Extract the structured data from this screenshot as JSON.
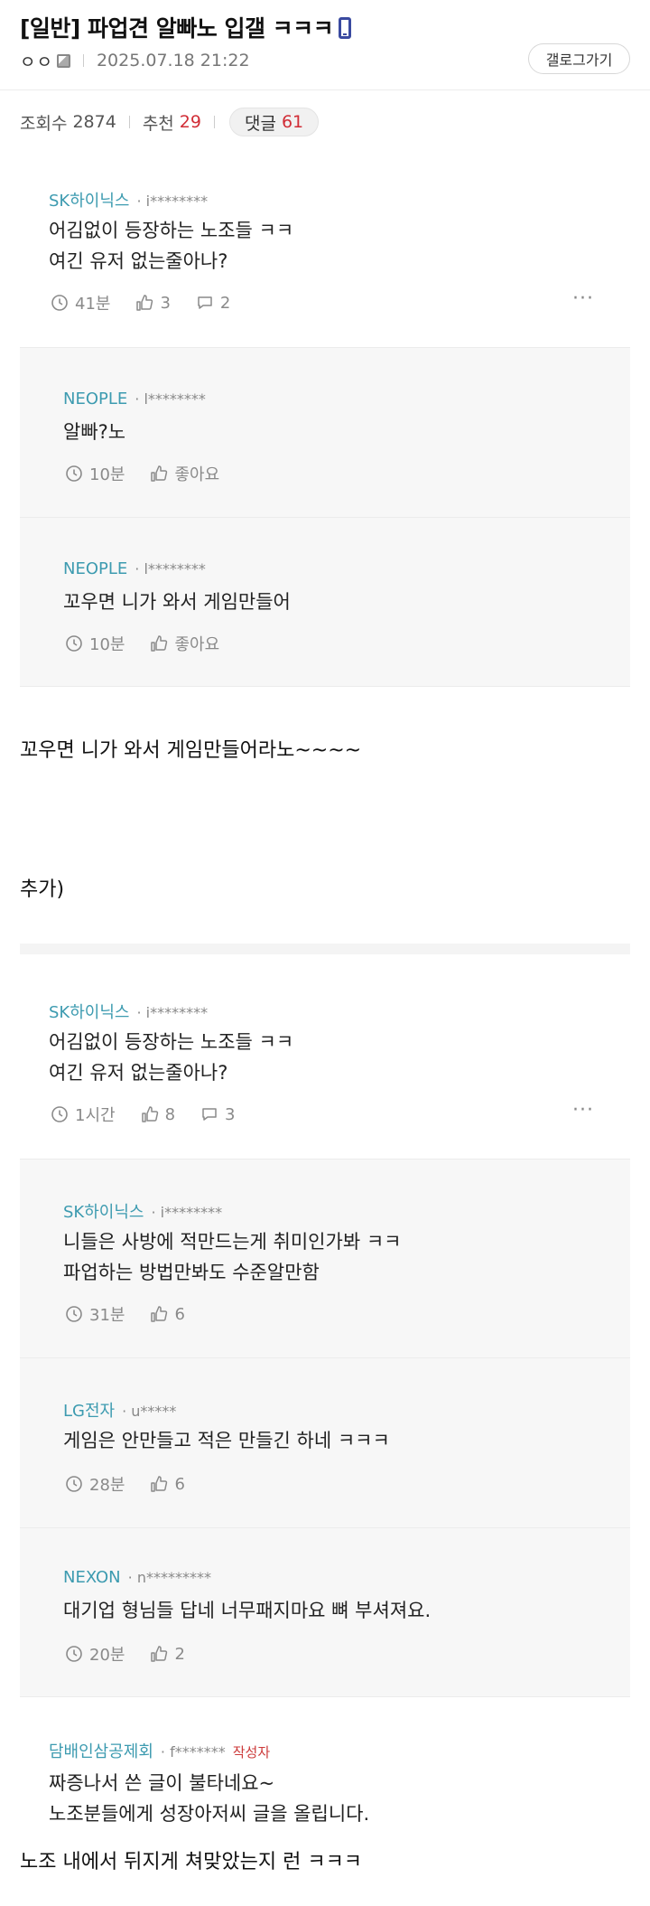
{
  "post": {
    "title": "[일반] 파업견 알빠노 입갤 ㅋㅋㅋ",
    "author": "ㅇㅇ",
    "date": "2025.07.18 21:22",
    "gallog_button": "갤로그가기",
    "stats": {
      "views_label": "조회수",
      "views": "2874",
      "recommend_label": "추천",
      "recommend": "29",
      "comments_label": "댓글",
      "comments": "61"
    }
  },
  "shot1": {
    "main": {
      "name": "SK하이닉스",
      "id": "· i********",
      "lines": [
        "어김없이 등장하는 노조들 ㅋㅋ",
        "여긴 유저 없는줄아나?"
      ],
      "time": "41분",
      "likes": "3",
      "replies": "2"
    },
    "reply1": {
      "name": "NEOPLE",
      "id": "· l********",
      "text": "알빠?노",
      "time": "10분",
      "likes": "좋아요"
    },
    "reply2": {
      "name": "NEOPLE",
      "id": "· l********",
      "text": "꼬우면 니가 와서 게임만들어",
      "time": "10분",
      "likes": "좋아요"
    }
  },
  "body": {
    "line1": "꼬우면 니가 와서 게임만들어라노~~~~",
    "line2": "추가)",
    "line3": "노조 내에서 뒤지게 쳐맞았는지 런 ㅋㅋㅋ"
  },
  "shot2": {
    "main": {
      "name": "SK하이닉스",
      "id": "· i********",
      "lines": [
        "어김없이 등장하는 노조들 ㅋㅋ",
        "여긴 유저 없는줄아나?"
      ],
      "time": "1시간",
      "likes": "8",
      "replies": "3"
    },
    "reply1": {
      "name": "SK하이닉스",
      "id": "· i********",
      "lines": [
        "니들은 사방에 적만드는게 취미인가봐 ㅋㅋ",
        "파업하는 방법만봐도 수준알만함"
      ],
      "time": "31분",
      "likes": "6"
    },
    "reply2": {
      "name": "LG전자",
      "id": "· u*****",
      "text": "게임은 안만들고 적은 만들긴 하네 ㅋㅋㅋ",
      "time": "28분",
      "likes": "6"
    },
    "reply3": {
      "name": "NEXON",
      "id": "· n*********",
      "text": "대기업 형님들 답네 너무패지마요 뼈 부셔져요.",
      "time": "20분",
      "likes": "2"
    },
    "writer": {
      "name": "담배인삼공제회",
      "id": "· f*******",
      "badge": "작성자",
      "lines": [
        "짜증나서 쓴 글이 불타네요~",
        "노조분들에게 성장아저씨 글을 올립니다."
      ]
    }
  },
  "more_label": "···",
  "colors": {
    "name_teal": "#3d9bb0",
    "accent_red": "#d12d36",
    "reply_bg": "#f7f7f7"
  }
}
